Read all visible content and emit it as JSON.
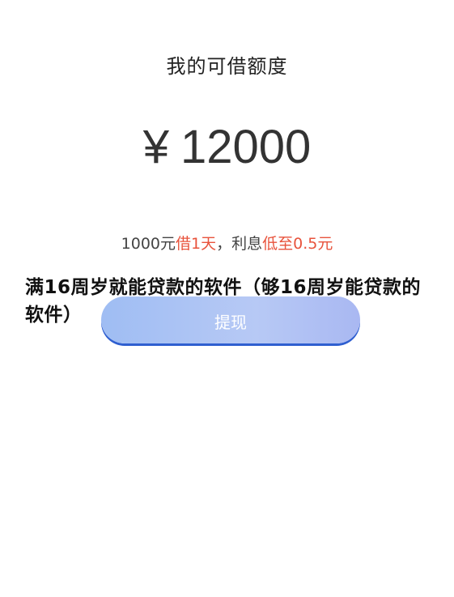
{
  "page": {
    "title": "我的可借额度",
    "amount": {
      "currency_symbol": "¥",
      "value": "12000"
    },
    "rate_line": {
      "prefix": "1000元",
      "highlight_1": "借1天",
      "middle": "，利息",
      "highlight_2": "低至0.5元"
    },
    "withdraw_button_label": "提现"
  },
  "overlay": {
    "caption": "满16周岁就能贷款的软件（够16周岁能贷款的软件）"
  },
  "colors": {
    "highlight": "#e8533c",
    "button_gradient_start": "#9fbdf3",
    "button_gradient_end": "#a9b8f2",
    "button_border": "#2f5fd0"
  }
}
